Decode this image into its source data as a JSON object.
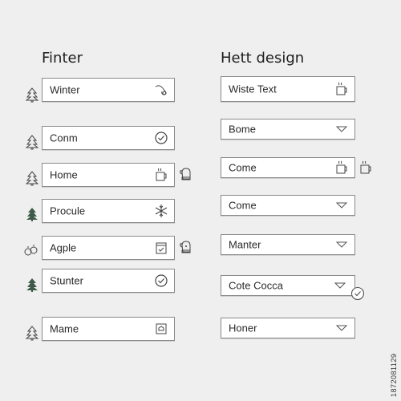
{
  "left_panel": {
    "title": "Finter",
    "fields": [
      {
        "label": "Winter",
        "icon": "horn-icon"
      },
      {
        "label": "Conm",
        "icon": "check-circle-icon"
      },
      {
        "label": "Home",
        "icon": "mug-icon"
      },
      {
        "label": "Procule",
        "icon": "snowflake-icon"
      },
      {
        "label": "Agple",
        "icon": "calendar-check-icon"
      },
      {
        "label": "Stunter",
        "icon": "check-circle-icon"
      },
      {
        "label": "Mame",
        "icon": "home-box-icon"
      }
    ]
  },
  "right_panel": {
    "title": "Hett design",
    "fields": [
      {
        "label": "Wiste Text",
        "icon": "mug-icon"
      },
      {
        "label": "Bome",
        "icon": "dropdown-triangle-icon"
      },
      {
        "label": "Come",
        "icon": "mug-icon"
      },
      {
        "label": "Come",
        "icon": "dropdown-triangle-icon"
      },
      {
        "label": "Manter",
        "icon": "dropdown-triangle-icon"
      },
      {
        "label": "Cote Cocca",
        "icon": "dropdown-triangle-icon"
      },
      {
        "label": "Honer",
        "icon": "dropdown-triangle-icon"
      }
    ]
  },
  "side_icons": [
    "tree-outline-icon",
    "tree-outline-icon",
    "tree-outline-icon",
    "tree-filled-icon",
    "ornaments-icon",
    "tree-filled-icon",
    "tree-outline-icon"
  ],
  "watermark_id": "1872081129",
  "colors": {
    "background": "#efefef",
    "border": "#8a8a8a",
    "tree_fill": "#3e5a48"
  }
}
